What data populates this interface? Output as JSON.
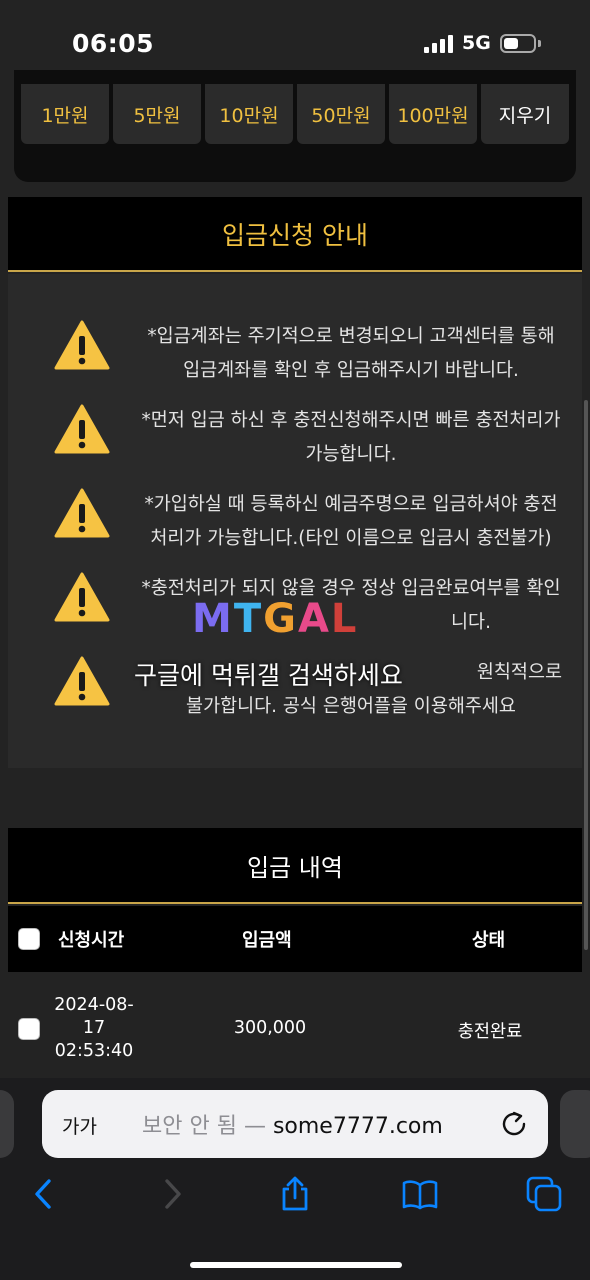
{
  "status_bar": {
    "time": "06:05",
    "network": "5G"
  },
  "amount_buttons": [
    "1만원",
    "5만원",
    "10만원",
    "50만원",
    "100만원"
  ],
  "clear_label": "지우기",
  "notice": {
    "title": "입금신청 안내",
    "items": [
      {
        "line1": "*입금계좌는 주기적으로 변경되오니 고객센터를 통해",
        "line2": "입금계좌를 확인 후 입금해주시기 바랍니다."
      },
      {
        "line1": "*먼저 입금 하신 후 충전신청해주시면 빠른 충전처리가",
        "line2": "가능합니다."
      },
      {
        "line1": "*가입하실 때 등록하신 예금주명으로 입금하셔야 충전",
        "line2": "처리가 가능합니다.(타인 이름으로 입금시 충전불가)"
      },
      {
        "line1": "*충전처리가 되지 않을 경우 정상 입금완료여부를 확인",
        "line2": "니다."
      },
      {
        "line1": "원칙적으로",
        "line2": "불가합니다. 공식 은행어플을 이용해주세요"
      }
    ]
  },
  "watermark": {
    "logo": "MTGAL",
    "subtitle": "구글에 먹튀갤 검색하세요"
  },
  "history": {
    "title": "입금 내역",
    "columns": [
      "신청시간",
      "입금액",
      "상태"
    ],
    "rows": [
      {
        "date": "2024-08-",
        "day": "17",
        "time": "02:53:40",
        "amount": "300,000",
        "status": "충전완료"
      }
    ]
  },
  "browser": {
    "aa_label": "가가",
    "insecure_label": "보안 안 됨 —",
    "domain": "some7777.com"
  },
  "colors": {
    "accent_gold": "#f0c040",
    "divider_gold": "#c9a64a",
    "warning_yellow": "#f6c343"
  },
  "icons": [
    "warning-icon",
    "reload-icon",
    "back-icon",
    "forward-icon",
    "share-icon",
    "bookmarks-icon",
    "tabs-icon"
  ]
}
